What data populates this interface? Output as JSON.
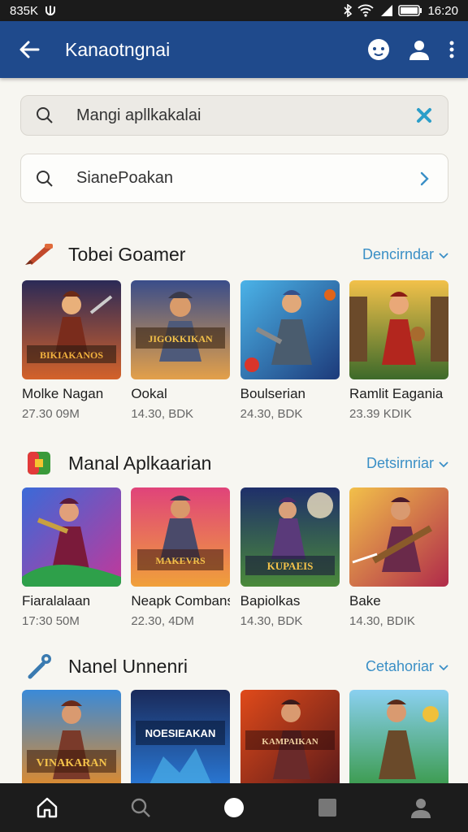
{
  "status": {
    "left_text": "835K",
    "time": "16:20",
    "icons": [
      "usb-icon",
      "bluetooth-icon",
      "wifi-icon",
      "signal-icon",
      "battery-icon"
    ]
  },
  "appbar": {
    "title": "Kanaotngnai",
    "icons": [
      "back-arrow-icon",
      "game-controller-icon",
      "account-icon",
      "more-vert-icon"
    ]
  },
  "search1": {
    "text": "Mangi apllkakalai",
    "icon": "search-icon",
    "action_icon": "clear-icon"
  },
  "search2": {
    "text": "SianePoakan",
    "icon": "search-icon",
    "action_icon": "chevron-right-icon"
  },
  "colors": {
    "primary": "#1f4a8c",
    "accent": "#3a8fc6",
    "background": "#f7f6f1",
    "navbar": "#1c1c1c"
  },
  "sections": [
    {
      "title": "Tobei Goamer",
      "more": "Dencirndar",
      "icon": "paintbrush-icon",
      "items": [
        {
          "name": "Molke Nagan",
          "meta": "27.30 09M",
          "art_text": "BIKIAKANOS"
        },
        {
          "name": "Ookal",
          "meta": "14.30, BDK",
          "art_text": "JIGOKKIKAN"
        },
        {
          "name": "Boulserian",
          "meta": "24.30, BDK",
          "art_text": ""
        },
        {
          "name": "Ramlit Eagania",
          "meta": "23.39 KDIK",
          "art_text": ""
        }
      ]
    },
    {
      "title": "Manal Aplkaarian",
      "more": "Detsirnriar",
      "icon": "app-tile-icon",
      "items": [
        {
          "name": "Fiaralalaan",
          "meta": "17:30 50M",
          "art_text": ""
        },
        {
          "name": "Neapk Combans",
          "meta": "22.30, 4DM",
          "art_text": "MAKEVRS"
        },
        {
          "name": "Bapiolkas",
          "meta": "14.30, BDK",
          "art_text": "KUPAEIS"
        },
        {
          "name": "Bake",
          "meta": "14.30, BDIK",
          "art_text": ""
        }
      ]
    },
    {
      "title": "Nanel Unnenri",
      "more": "Cetahoriar",
      "icon": "wrench-icon",
      "items": [
        {
          "name": "",
          "meta": "",
          "art_text": "VINAKARAN"
        },
        {
          "name": "",
          "meta": "",
          "art_text": "NOESIEAKAN"
        },
        {
          "name": "",
          "meta": "",
          "art_text": "KAMPAIKAN"
        },
        {
          "name": "",
          "meta": "",
          "art_text": ""
        }
      ]
    }
  ],
  "navbar": {
    "icons": [
      "home-icon",
      "search-icon",
      "circle-home-icon",
      "square-recents-icon",
      "profile-icon"
    ]
  }
}
